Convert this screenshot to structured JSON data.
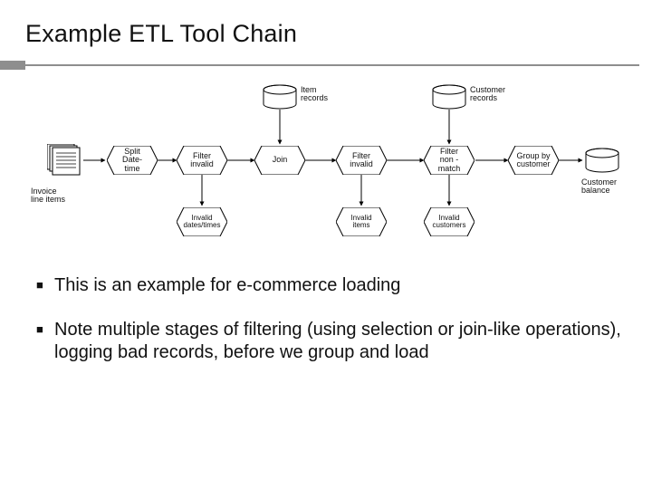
{
  "title": "Example ETL Tool Chain",
  "diagram": {
    "sources": {
      "item_records": "Item\nrecords",
      "customer_records": "Customer\nrecords",
      "invoice_line_items": "Invoice\nline items"
    },
    "stages": {
      "split_datetime": "Split\nDate-\ntime",
      "filter_invalid_1": "Filter\ninvalid",
      "join": "Join",
      "filter_invalid_2": "Filter\ninvalid",
      "filter_non_match": "Filter\nnon -\nmatch",
      "group_by_customer": "Group by\ncustomer"
    },
    "logs": {
      "invalid_dates_times": "Invalid\ndates/times",
      "invalid_items": "Invalid\nitems",
      "invalid_customers": "Invalid\ncustomers"
    },
    "sink": {
      "customer_balance": "Customer\nbalance"
    }
  },
  "bullets": {
    "b1": "This is an example for e-commerce loading",
    "b2": "Note multiple stages of filtering (using selection or join-like operations), logging bad records, before we group and load"
  }
}
